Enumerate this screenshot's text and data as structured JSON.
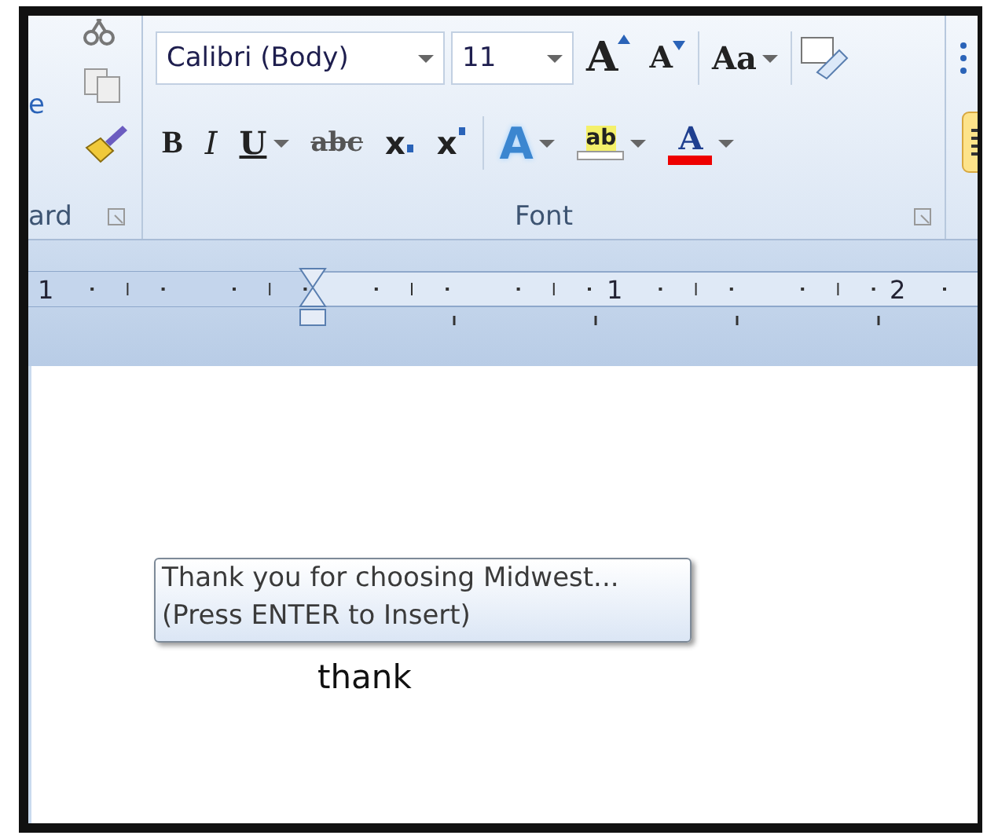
{
  "clipboard": {
    "paste_label_fragment": "e",
    "group_label": "ard"
  },
  "font_group": {
    "font_name": "Calibri (Body)",
    "font_size": "11",
    "label": "Font",
    "top_buttons": [
      {
        "kind": "grow",
        "glyph": "A"
      },
      {
        "kind": "shrink",
        "glyph": "A"
      },
      {
        "kind": "case",
        "glyph": "Aa"
      }
    ],
    "format_buttons": [
      {
        "kind": "bold",
        "glyph": "B"
      },
      {
        "kind": "italic",
        "glyph": "I"
      },
      {
        "kind": "underline",
        "glyph": "U"
      },
      {
        "kind": "strike",
        "glyph": "abc"
      },
      {
        "kind": "sub",
        "glyph": "x"
      },
      {
        "kind": "super",
        "glyph": "x"
      },
      {
        "kind": "effects",
        "glyph": "A"
      },
      {
        "kind": "highlight",
        "glyph": "ab"
      },
      {
        "kind": "color",
        "glyph": "A"
      }
    ]
  },
  "ruler": {
    "numbers": [
      "1",
      "1",
      "2"
    ]
  },
  "document": {
    "typed_text": "thank",
    "autocomplete": {
      "suggestion": "Thank you for choosing Midwest...",
      "hint": "(Press ENTER to Insert)"
    }
  }
}
